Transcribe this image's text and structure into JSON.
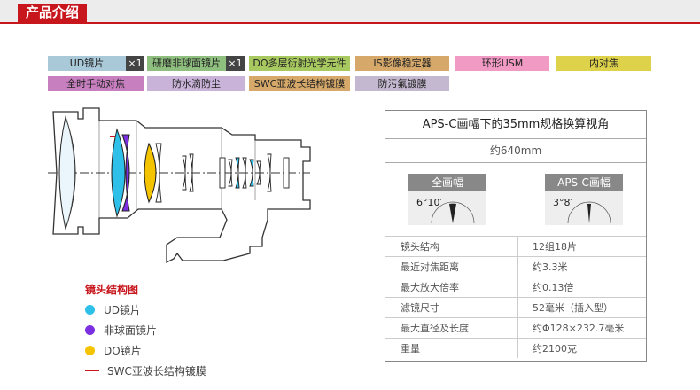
{
  "header": {
    "title": "产品介绍"
  },
  "tags": {
    "row1": [
      {
        "label": "UD镜片",
        "color": "#a9c9d9"
      },
      {
        "label": "研磨非球面镜片",
        "color": "#8fbf7f"
      },
      {
        "label": "DO多层衍射光学元件",
        "color": "#a8c860"
      },
      {
        "label": "IS影像稳定器",
        "color": "#d6a96a"
      },
      {
        "label": "环形USM",
        "color": "#f19ac4"
      },
      {
        "label": "内对焦",
        "color": "#ddd24a"
      }
    ],
    "row2": [
      {
        "label": "全时手动对焦",
        "color": "#c77fc0"
      },
      {
        "label": "防水滴防尘",
        "color": "#c9b3d9"
      },
      {
        "label": "SWC亚波长结构镀膜",
        "color": "#d6a96a"
      },
      {
        "label": "防污氟镀膜",
        "color": "#c3b8cf"
      }
    ],
    "count_ud": "×1",
    "count_aspherical": "×1"
  },
  "legend": {
    "title": "镜头结构图",
    "items": [
      {
        "label": "UD镜片",
        "color": "#2ec0e8"
      },
      {
        "label": "非球面镜片",
        "color": "#7b2fe0"
      },
      {
        "label": "DO镜片",
        "color": "#f5c400"
      },
      {
        "label": "SWC亚波长结构镀膜",
        "color": "#c8161d"
      }
    ]
  },
  "specs": {
    "title": "APS-C画幅下的35mm规格换算视角",
    "equiv": "约640mm",
    "fullframe": {
      "label": "全画幅",
      "angle": "6°10′"
    },
    "apsc": {
      "label": "APS-C画幅",
      "angle": "3°8′"
    },
    "rows": [
      {
        "key": "镜头结构",
        "value": "12组18片"
      },
      {
        "key": "最近对焦距离",
        "value": "约3.3米"
      },
      {
        "key": "最大放大倍率",
        "value": "约0.13倍"
      },
      {
        "key": "滤镜尺寸",
        "value": "52毫米（插入型）"
      },
      {
        "key": "最大直径及长度",
        "value": "约Φ128×232.7毫米"
      },
      {
        "key": "重量",
        "value": "约2100克"
      }
    ]
  }
}
